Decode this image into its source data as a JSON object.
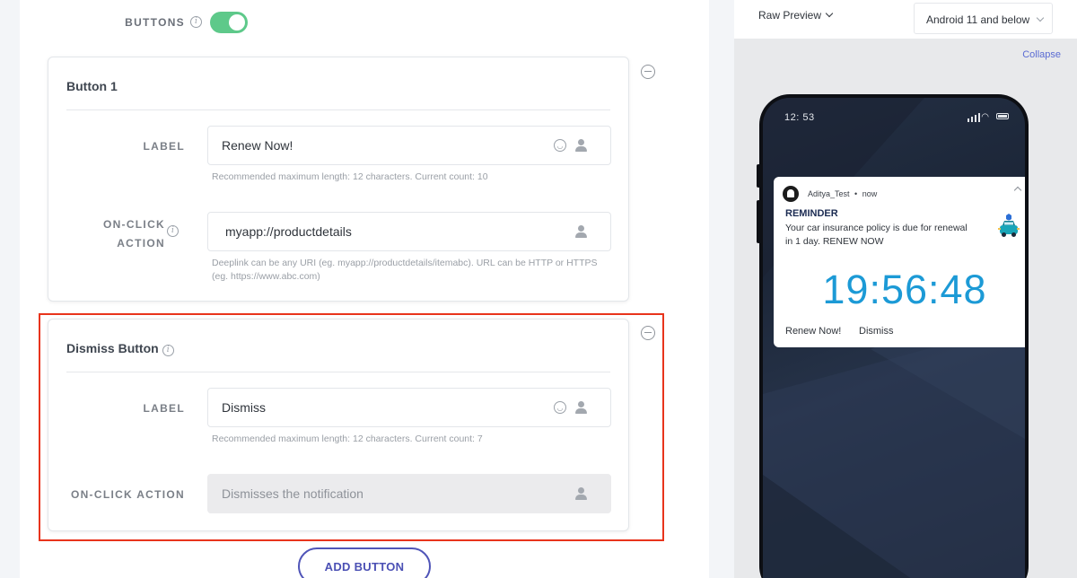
{
  "editor": {
    "buttons_toggle": {
      "label": "BUTTONS",
      "on": true
    },
    "button1": {
      "title": "Button 1",
      "label_field": {
        "label": "LABEL",
        "value": "Renew Now!",
        "hint": "Recommended maximum length: 12 characters. Current count: 10"
      },
      "onclick_field": {
        "label_line1": "ON-CLICK",
        "label_line2": "ACTION",
        "value": "myapp://productdetails",
        "hint_line1": "Deeplink can be any URI (eg. myapp://productdetails/itemabc). URL can be HTTP or HTTPS",
        "hint_line2": "(eg. https://www.abc.com)"
      }
    },
    "dismiss_button": {
      "title": "Dismiss Button",
      "label_field": {
        "label": "LABEL",
        "value": "Dismiss",
        "hint": "Recommended maximum length: 12 characters. Current count: 7"
      },
      "onclick_field": {
        "label": "ON-CLICK ACTION",
        "value": "Dismisses the notification"
      }
    },
    "add_button_label": "ADD BUTTON",
    "highlight_color": "#e8341c"
  },
  "preview": {
    "mode_label": "Raw Preview",
    "os_select": "Android 11 and below",
    "collapse_label": "Collapse",
    "phone": {
      "status_time": "12: 53",
      "notification": {
        "app_name": "Aditya_Test",
        "separator": "•",
        "time": "now",
        "title": "REMINDER",
        "body": "Your car insurance policy is due for renewal in 1 day. RENEW NOW",
        "timer": "19:56:48",
        "actions": [
          "Renew Now!",
          "Dismiss"
        ]
      }
    }
  },
  "colors": {
    "toggle_on": "#5ec98a",
    "accent": "#4b50b4",
    "timer": "#1c9ad6",
    "link": "#5a6bd3"
  }
}
